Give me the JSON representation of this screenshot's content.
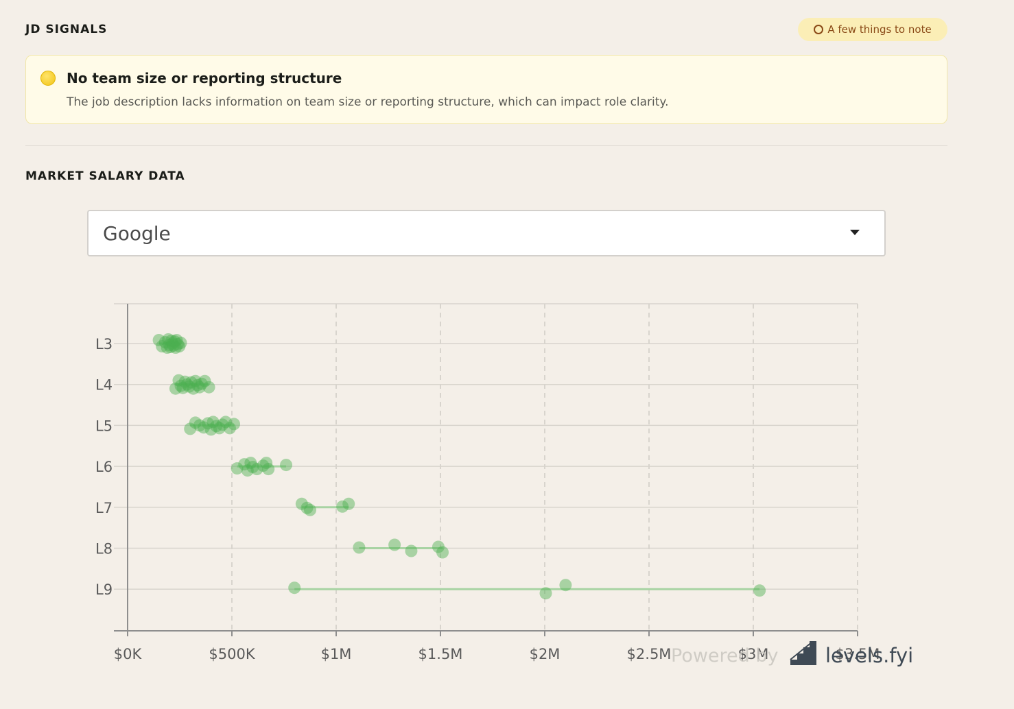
{
  "jd_signals": {
    "title": "JD SIGNALS",
    "badge": "A few things to note",
    "signals": [
      {
        "heading": "No team size or reporting structure",
        "body": "The job description lacks information on team size or reporting structure, which can impact role clarity."
      }
    ]
  },
  "market_salary": {
    "title": "MARKET SALARY DATA",
    "company_select": {
      "selected": "Google"
    },
    "attribution": {
      "powered_by": "Powered by",
      "brand": "levels.fyi"
    }
  },
  "colors": {
    "background": "#f4efe8",
    "badge_bg": "#fbeeb6",
    "badge_text": "#8a4a17",
    "signal_card_bg": "#fffbe8",
    "point": "#4caf50"
  },
  "chart_data": {
    "type": "scatter",
    "x_ticks": [
      "$0K",
      "$500K",
      "$1M",
      "$1.5M",
      "$2M",
      "$2.5M",
      "$3M",
      "$3.5M"
    ],
    "xlim": [
      0,
      3500000
    ],
    "categories": [
      "L3",
      "L4",
      "L5",
      "L6",
      "L7",
      "L8",
      "L9"
    ],
    "grid": true,
    "series": [
      {
        "level": "L3",
        "values": [
          150000,
          165000,
          180000,
          190000,
          195000,
          200000,
          205000,
          210000,
          215000,
          220000,
          225000,
          230000,
          235000,
          240000,
          248000,
          255000
        ]
      },
      {
        "level": "L4",
        "values": [
          230000,
          245000,
          255000,
          265000,
          275000,
          285000,
          295000,
          305000,
          315000,
          325000,
          335000,
          345000,
          355000,
          370000,
          390000
        ]
      },
      {
        "level": "L5",
        "values": [
          300000,
          325000,
          345000,
          365000,
          385000,
          400000,
          410000,
          425000,
          440000,
          455000,
          470000,
          490000,
          510000
        ]
      },
      {
        "level": "L6",
        "values": [
          525000,
          560000,
          575000,
          590000,
          600000,
          620000,
          650000,
          665000,
          675000,
          760000
        ]
      },
      {
        "level": "L7",
        "values": [
          835000,
          860000,
          875000,
          1030000,
          1060000
        ]
      },
      {
        "level": "L8",
        "values": [
          1110000,
          1280000,
          1360000,
          1490000,
          1510000
        ]
      },
      {
        "level": "L9",
        "values": [
          800000,
          2005000,
          2100000,
          3030000
        ]
      }
    ]
  }
}
